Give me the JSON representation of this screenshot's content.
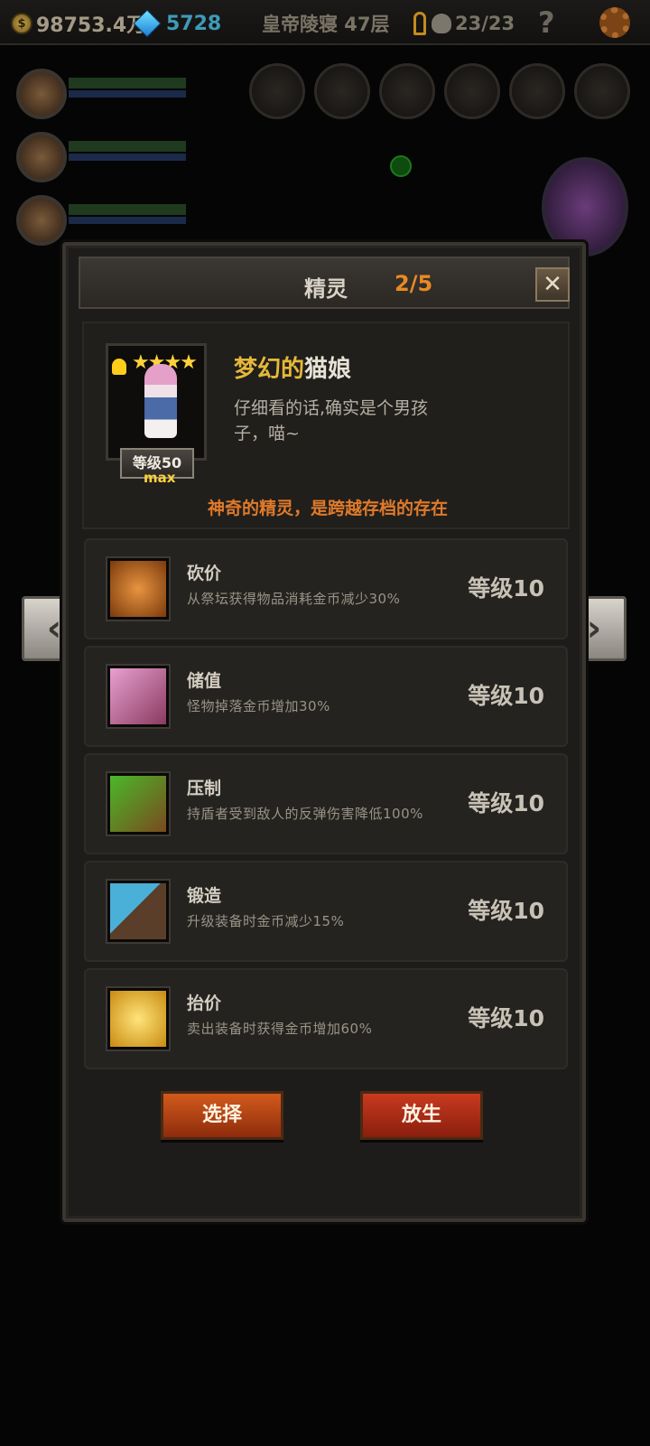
{
  "hud": {
    "gold": "98753.4万",
    "gems": "5728",
    "floor": "皇帝陵寝 47层",
    "kills": "23/23",
    "help": "?"
  },
  "modal": {
    "title": "精灵",
    "count": "2/5",
    "close": "✕"
  },
  "pet": {
    "stars": "★★★★",
    "level_label": "等级50",
    "max_label": "max",
    "name_part1": "梦幻的",
    "name_part2": "猫娘",
    "description": "仔细看的话,确实是个男孩子，喵~",
    "tagline": "神奇的精灵，是跨越存档的存在"
  },
  "skills": [
    {
      "name": "砍价",
      "desc": "从祭坛获得物品消耗金币减少30%",
      "level": "等级10",
      "icon": "coin-pile-icon"
    },
    {
      "name": "储值",
      "desc": "怪物掉落金币增加30%",
      "level": "等级10",
      "icon": "chalice-icon"
    },
    {
      "name": "压制",
      "desc": "持盾者受到敌人的反弹伤害降低100%",
      "level": "等级10",
      "icon": "claw-icon"
    },
    {
      "name": "锻造",
      "desc": "升级装备时金币减少15%",
      "level": "等级10",
      "icon": "hammer-icon"
    },
    {
      "name": "抬价",
      "desc": "卖出装备时获得金币增加60%",
      "level": "等级10",
      "icon": "golden-hand-icon"
    }
  ],
  "buttons": {
    "select": "选择",
    "release": "放生"
  },
  "nav": {
    "prev": "‹",
    "next": "›"
  },
  "colors": {
    "accent_orange": "#e88a22",
    "tagline_orange": "#e07a2a",
    "name_gold": "#e6b83a",
    "button_red": "#c8401c"
  }
}
